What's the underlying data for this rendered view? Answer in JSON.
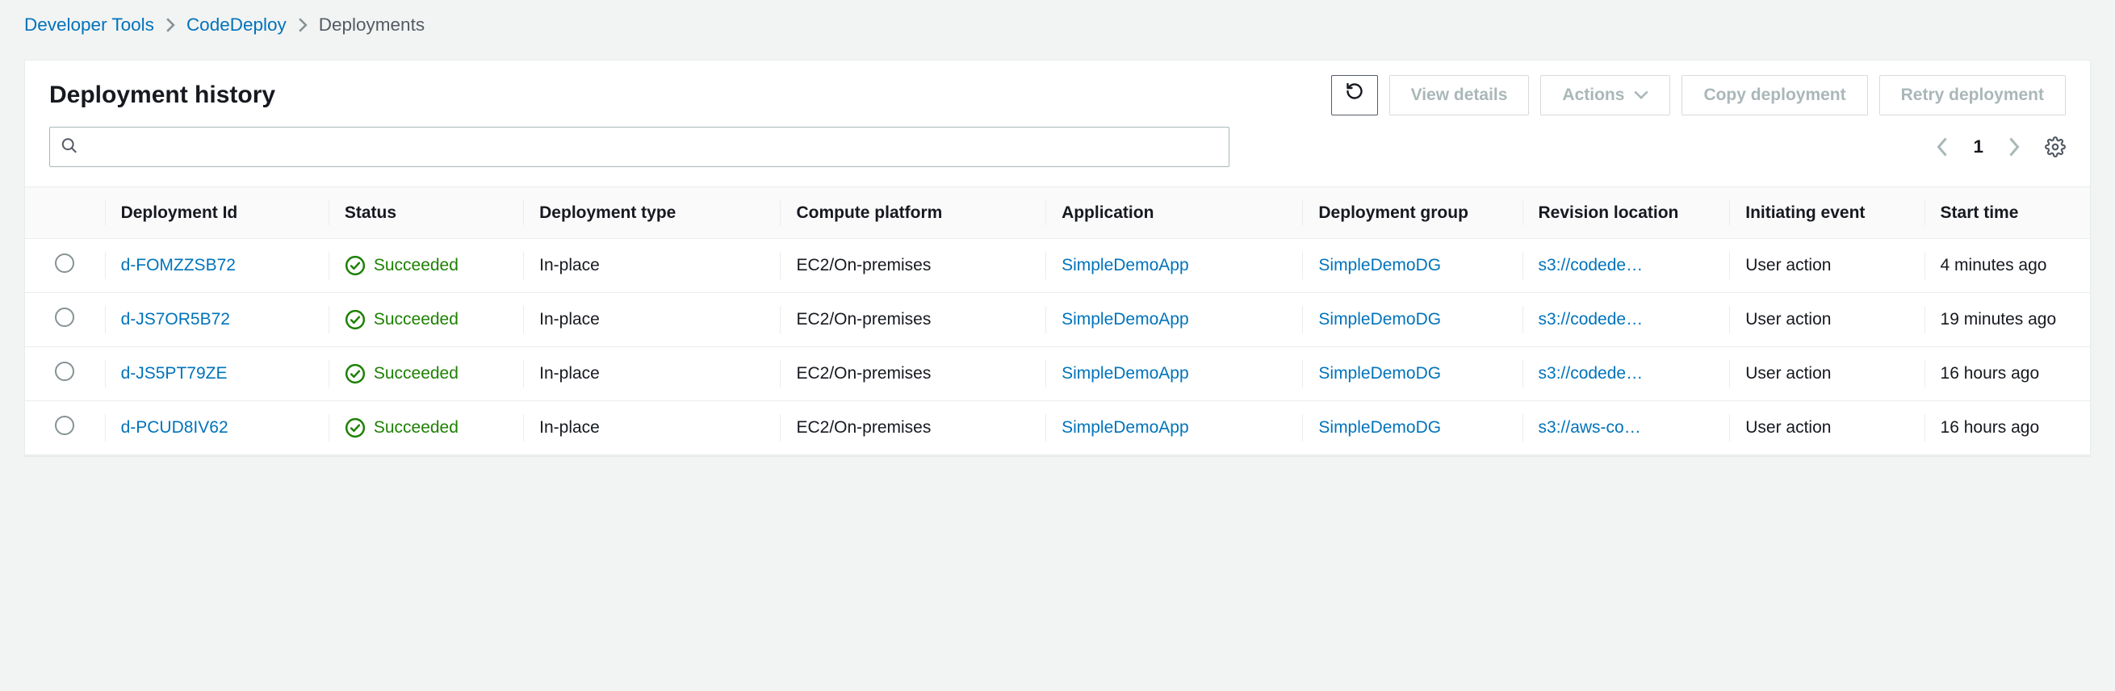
{
  "breadcrumb": {
    "items": [
      {
        "label": "Developer Tools",
        "link": true
      },
      {
        "label": "CodeDeploy",
        "link": true
      },
      {
        "label": "Deployments",
        "link": false
      }
    ]
  },
  "header": {
    "title": "Deployment history",
    "refresh_label": "Refresh",
    "view_details_label": "View details",
    "actions_label": "Actions",
    "copy_label": "Copy deployment",
    "retry_label": "Retry deployment"
  },
  "search": {
    "value": "",
    "placeholder": ""
  },
  "pager": {
    "page": "1",
    "prev_enabled": false,
    "next_enabled": false
  },
  "table": {
    "columns": {
      "deployment_id": "Deployment Id",
      "status": "Status",
      "deployment_type": "Deployment type",
      "compute_platform": "Compute platform",
      "application": "Application",
      "deployment_group": "Deployment group",
      "revision_location": "Revision location",
      "initiating_event": "Initiating event",
      "start_time": "Start time"
    },
    "rows": [
      {
        "id": "d-FOMZZSB72",
        "status": "Succeeded",
        "type": "In-place",
        "platform": "EC2/On-premises",
        "application": "SimpleDemoApp",
        "group": "SimpleDemoDG",
        "revision": "s3://codede…",
        "event": "User action",
        "time": "4 minutes ago"
      },
      {
        "id": "d-JS7OR5B72",
        "status": "Succeeded",
        "type": "In-place",
        "platform": "EC2/On-premises",
        "application": "SimpleDemoApp",
        "group": "SimpleDemoDG",
        "revision": "s3://codede…",
        "event": "User action",
        "time": "19 minutes ago"
      },
      {
        "id": "d-JS5PT79ZE",
        "status": "Succeeded",
        "type": "In-place",
        "platform": "EC2/On-premises",
        "application": "SimpleDemoApp",
        "group": "SimpleDemoDG",
        "revision": "s3://codede…",
        "event": "User action",
        "time": "16 hours ago"
      },
      {
        "id": "d-PCUD8IV62",
        "status": "Succeeded",
        "type": "In-place",
        "platform": "EC2/On-premises",
        "application": "SimpleDemoApp",
        "group": "SimpleDemoDG",
        "revision": "s3://aws-co…",
        "event": "User action",
        "time": "16 hours ago"
      }
    ]
  }
}
